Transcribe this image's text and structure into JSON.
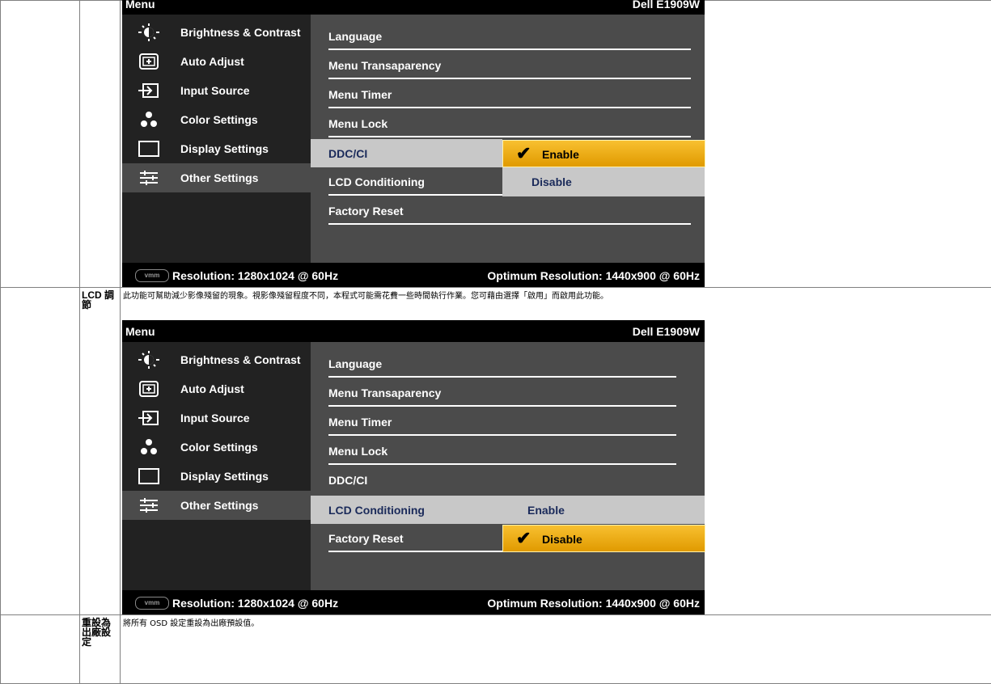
{
  "osd": {
    "menu_title": "Menu",
    "model": "Dell E1909W",
    "left_items": [
      {
        "label": "Brightness & Contrast",
        "icon": "brightness-icon"
      },
      {
        "label": "Auto Adjust",
        "icon": "auto-adjust-icon"
      },
      {
        "label": "Input Source",
        "icon": "input-source-icon"
      },
      {
        "label": "Color Settings",
        "icon": "color-settings-icon"
      },
      {
        "label": "Display Settings",
        "icon": "display-settings-icon"
      },
      {
        "label": "Other Settings",
        "icon": "other-settings-icon"
      }
    ],
    "sub_items": [
      "Language",
      "Menu Transaparency",
      "Menu Timer",
      "Menu Lock",
      "DDC/CI",
      "LCD Conditioning",
      "Factory Reset"
    ],
    "resolution": "Resolution: 1280x1024 @ 60Hz",
    "optimum": "Optimum Resolution: 1440x900 @ 60Hz",
    "enable": "Enable",
    "disable": "Disable",
    "vmm_logo": "vmm"
  },
  "rows": {
    "lcd": {
      "label": "LCD 調節",
      "desc": "此功能可幫助減少影像殘留的現象。視影像殘留程度不同，本程式可能需花費一些時間執行作業。您可藉由選擇「啟用」而啟用此功能。"
    },
    "reset": {
      "label": "重設為出廠設定",
      "desc": "將所有 OSD 設定重設為出廠預設值。"
    }
  },
  "colors": {
    "osd_bg": "#4b4b4b",
    "left_bg": "#222222",
    "highlight": "#c8c8c8",
    "selected_option": "#f0b020"
  }
}
